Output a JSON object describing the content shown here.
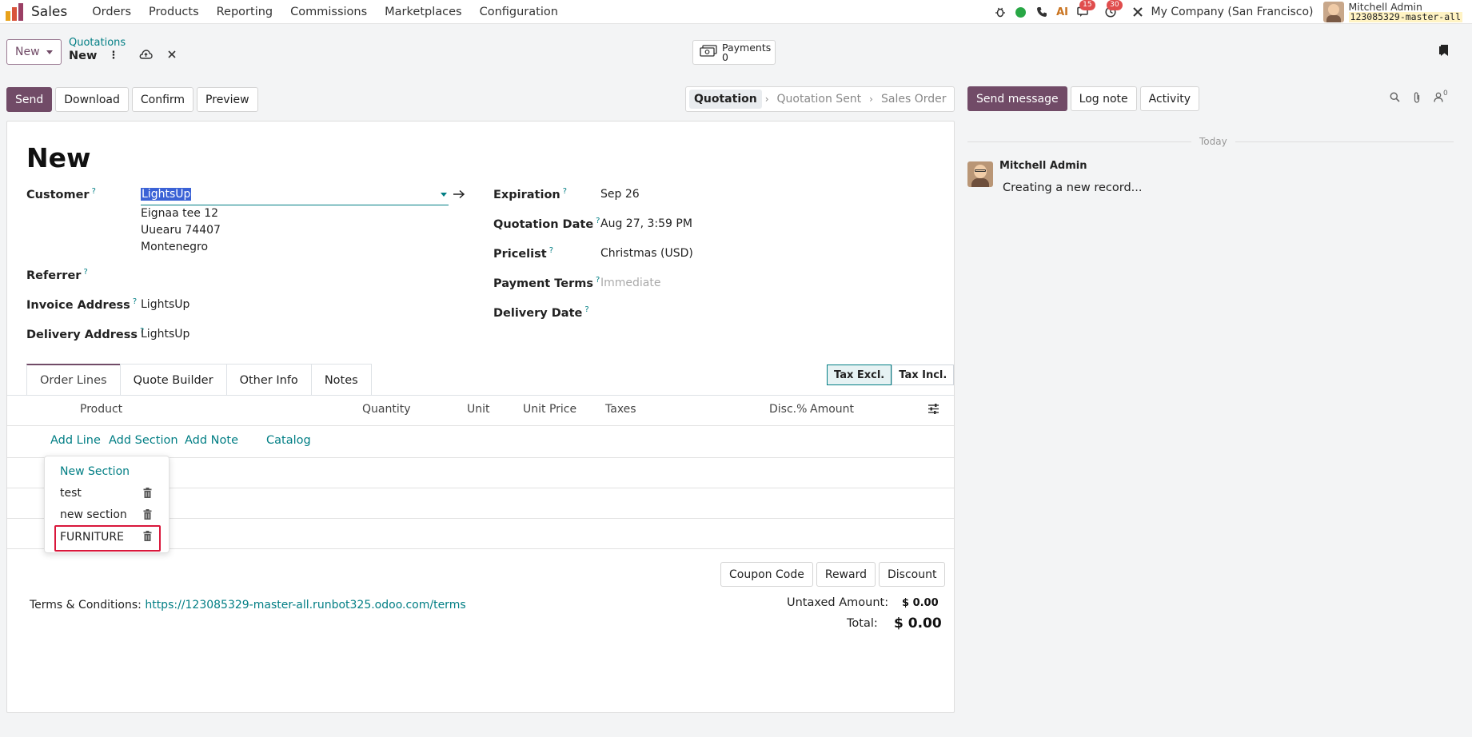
{
  "navbar": {
    "app_name": "Sales",
    "menu": [
      "Orders",
      "Products",
      "Reporting",
      "Commissions",
      "Marketplaces",
      "Configuration"
    ],
    "messages_count": "15",
    "activities_count": "30",
    "company": "My Company (San Francisco)",
    "user_name": "Mitchell Admin",
    "user_db": "123085329-master-all"
  },
  "control": {
    "new_label": "New",
    "breadcrumb_parent": "Quotations",
    "breadcrumb_current": "New",
    "payments_label": "Payments",
    "payments_count": "0"
  },
  "actions": {
    "send": "Send",
    "download": "Download",
    "confirm": "Confirm",
    "preview": "Preview"
  },
  "status": {
    "stages": [
      "Quotation",
      "Quotation Sent",
      "Sales Order"
    ]
  },
  "form": {
    "title": "New",
    "customer_label": "Customer",
    "customer_value": "LightsUp",
    "address": [
      "Eignaa tee 12",
      "Uuearu 74407",
      "Montenegro"
    ],
    "referrer_label": "Referrer",
    "invoice_label": "Invoice Address",
    "invoice_value": "LightsUp",
    "delivery_label": "Delivery Address",
    "delivery_value": "LightsUp",
    "expiration_label": "Expiration",
    "expiration_value": "Sep 26",
    "quote_date_label": "Quotation Date",
    "quote_date_value": "Aug 27, 3:59 PM",
    "pricelist_label": "Pricelist",
    "pricelist_value": "Christmas (USD)",
    "payment_terms_label": "Payment Terms",
    "payment_terms_placeholder": "Immediate",
    "delivery_date_label": "Delivery Date"
  },
  "tabs": [
    "Order Lines",
    "Quote Builder",
    "Other Info",
    "Notes"
  ],
  "tax_toggle": {
    "excl": "Tax Excl.",
    "incl": "Tax Incl."
  },
  "table": {
    "headers": [
      "Product",
      "Quantity",
      "Unit",
      "Unit Price",
      "Taxes",
      "Disc.%",
      "Amount"
    ],
    "links": [
      "Add Line",
      "Add Section",
      "Add Note",
      "Catalog"
    ]
  },
  "dropdown": {
    "items": [
      "New Section",
      "test",
      "new section",
      "FURNITURE"
    ]
  },
  "promo": {
    "coupon": "Coupon Code",
    "reward": "Reward",
    "discount": "Discount"
  },
  "terms": {
    "label": "Terms & Conditions:",
    "link": "https://123085329-master-all.runbot325.odoo.com/terms"
  },
  "totals": {
    "untaxed_label": "Untaxed Amount:",
    "untaxed_value": "$ 0.00",
    "total_label": "Total:",
    "total_value": "$ 0.00"
  },
  "chatter": {
    "send_message": "Send message",
    "log_note": "Log note",
    "activity": "Activity",
    "followers_count": "0",
    "today": "Today",
    "author": "Mitchell Admin",
    "body": "Creating a new record..."
  }
}
